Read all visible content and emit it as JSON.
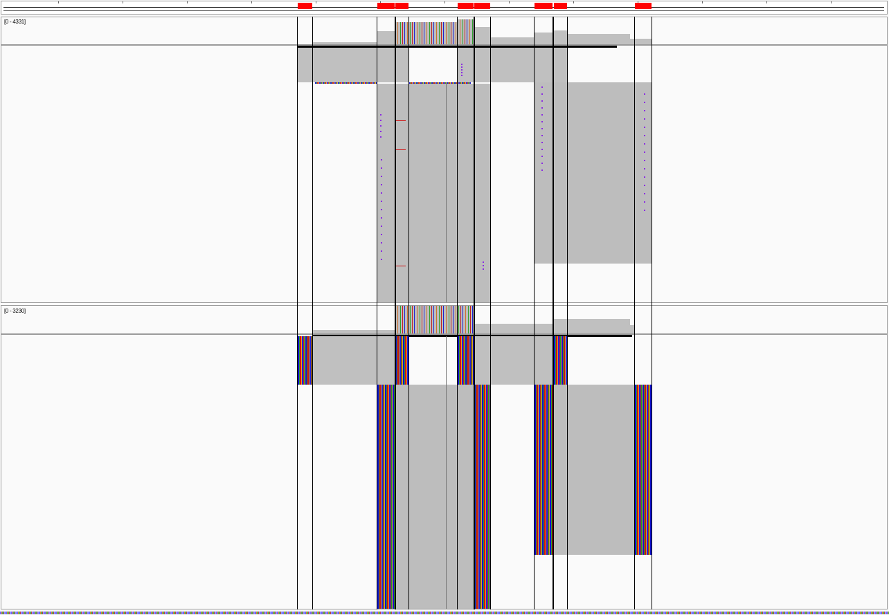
{
  "tracks": [
    {
      "range_label": "[0 - 4331]"
    },
    {
      "range_label": "[0 - 3230]"
    }
  ],
  "colors": {
    "exon": "#ff0000",
    "read": "#c0c0c0",
    "border": "#000000",
    "base_A": "#30a030",
    "base_C": "#1010d0",
    "base_G": "#e8a020",
    "base_T": "#d01010",
    "insertion": "#8a2be2"
  }
}
